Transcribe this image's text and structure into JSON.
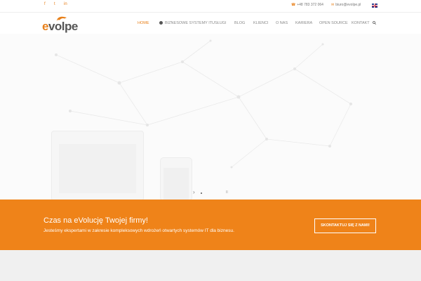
{
  "topbar": {
    "social": [
      {
        "icon": "facebook-icon",
        "glyph": "f"
      },
      {
        "icon": "twitter-icon",
        "glyph": "t"
      },
      {
        "icon": "linkedin-icon",
        "glyph": "in"
      }
    ],
    "phone": "+48 783 372 064",
    "email": "biuro@evolpe.pl",
    "language_flag": "flag-uk-icon"
  },
  "logo": {
    "letter": "e",
    "rest": "volpe"
  },
  "nav": {
    "items": [
      {
        "label": "HOME",
        "active": true
      },
      {
        "label": "BIZNESOWE SYSTEMY IT",
        "active": false
      },
      {
        "label": "USŁUGI",
        "active": false
      },
      {
        "label": "BLOG",
        "active": false
      },
      {
        "label": "KLIENCI",
        "active": false
      },
      {
        "label": "O NAS",
        "active": false
      },
      {
        "label": "KARIERA",
        "active": false
      },
      {
        "label": "OPEN SOURCE",
        "active": false
      },
      {
        "label": "KONTAKT",
        "active": false
      }
    ]
  },
  "slider": {
    "arrow": "›",
    "pause": "II"
  },
  "banner": {
    "title": "Czas na eVolucję Twojej firmy!",
    "subtitle": "Jesteśmy ekspertami w zakresie kompleksowych wdrożeń otwartych systemów IT dla biznesu.",
    "cta_label": "SKONTAKTUJ SIĘ Z NAMI!"
  },
  "colors": {
    "accent": "#ef8319",
    "text": "#555555"
  }
}
